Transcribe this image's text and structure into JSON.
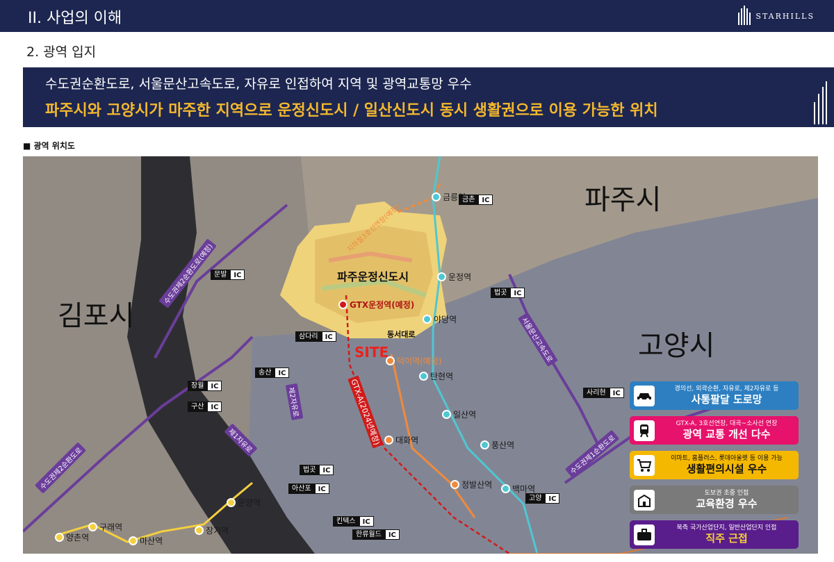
{
  "header": {
    "title": "II. 사업의 이해",
    "brand": "STARHILLS"
  },
  "subtitle": "2. 광역 입지",
  "banner": {
    "line1": "수도권순환도로, 서울문산고속도로, 자유로 인접하여 지역 및 광역교통망 우수",
    "line2": "파주시와 고양시가 마주한 지역으로 운정신도시 / 일산신도시 동시 생활권으로 이용 가능한 위치"
  },
  "map_section": {
    "label": "■ 광역 위치도"
  },
  "colors": {
    "navy": "#1c2650",
    "gold": "#f5b82e",
    "line_cyan": "#4fc7d3",
    "line_orange": "#f08a3c",
    "gtx_red": "#d01a1a"
  },
  "map": {
    "cities": {
      "paju": "파주시",
      "gimpo": "김포시",
      "goyang": "고양시"
    },
    "district": "파주운정신도시",
    "site": "SITE",
    "stations": {
      "geumneung": "금릉역",
      "unjeong": "운정역",
      "yadang": "야당역",
      "gtx_unjeong": "GTX운정역(예정)",
      "deogi": "덕이역(예정)",
      "tanhyeon": "탄현역",
      "ilsan": "일산역",
      "pungsan": "풍산역",
      "baengma": "백마역",
      "daehwa": "대화역",
      "jeongbalsan": "정발산역",
      "unyang": "운양역",
      "janggi": "장기역",
      "masan": "마산역",
      "gurae": "구래역",
      "yangchon": "양촌역"
    },
    "ics": {
      "geumchon": "금촌",
      "munbal": "문발",
      "beopgot1": "법곳",
      "samdari": "삼다리",
      "songsan": "송산",
      "janghwol": "장월",
      "gusan": "구산",
      "sarihyeon": "사리현",
      "beopgot2": "법곳",
      "asanpo": "아산포",
      "kintex": "킨텍스",
      "hanryu": "한류월드",
      "goyang": "고양",
      "ic_tag": "IC"
    },
    "roads": {
      "ring2": "수도권제2순환도로(예정)",
      "ring2b": "수도권제2순환도로",
      "seoul_munsan": "서울문산고속도로",
      "jayu1": "제1자유로",
      "jayu2": "제2자유로",
      "ring1": "수도권제1순환도로",
      "line3": "지하철3호선연장(예정)",
      "gtx": "GTX-A(2024년예정)",
      "dongseo": "동서대로"
    }
  },
  "features": [
    {
      "icon": "car-icon",
      "color": "#2d7fc1",
      "small": "경의선, 외곽순환, 자유로, 제2자유로 등",
      "big": "사통팔달 도로망"
    },
    {
      "icon": "train-icon",
      "color": "#e6126b",
      "small": "GTX-A, 3호선연장, 대곡~소사선 연장",
      "big": "광역 교통 개선 다수"
    },
    {
      "icon": "cart-icon",
      "color": "#f5b800",
      "small": "이마트, 홈플러스, 롯데아울렛 등 이용 가능",
      "big": "생활편의시설 우수"
    },
    {
      "icon": "school-icon",
      "color": "#7a7a7a",
      "small": "도보권 초중 인접",
      "big": "교육환경 우수"
    },
    {
      "icon": "briefcase-icon",
      "color": "#5a1d8c",
      "small": "북측 국가산업단지, 일반산업단지 인접",
      "big": "직주 근접"
    }
  ]
}
